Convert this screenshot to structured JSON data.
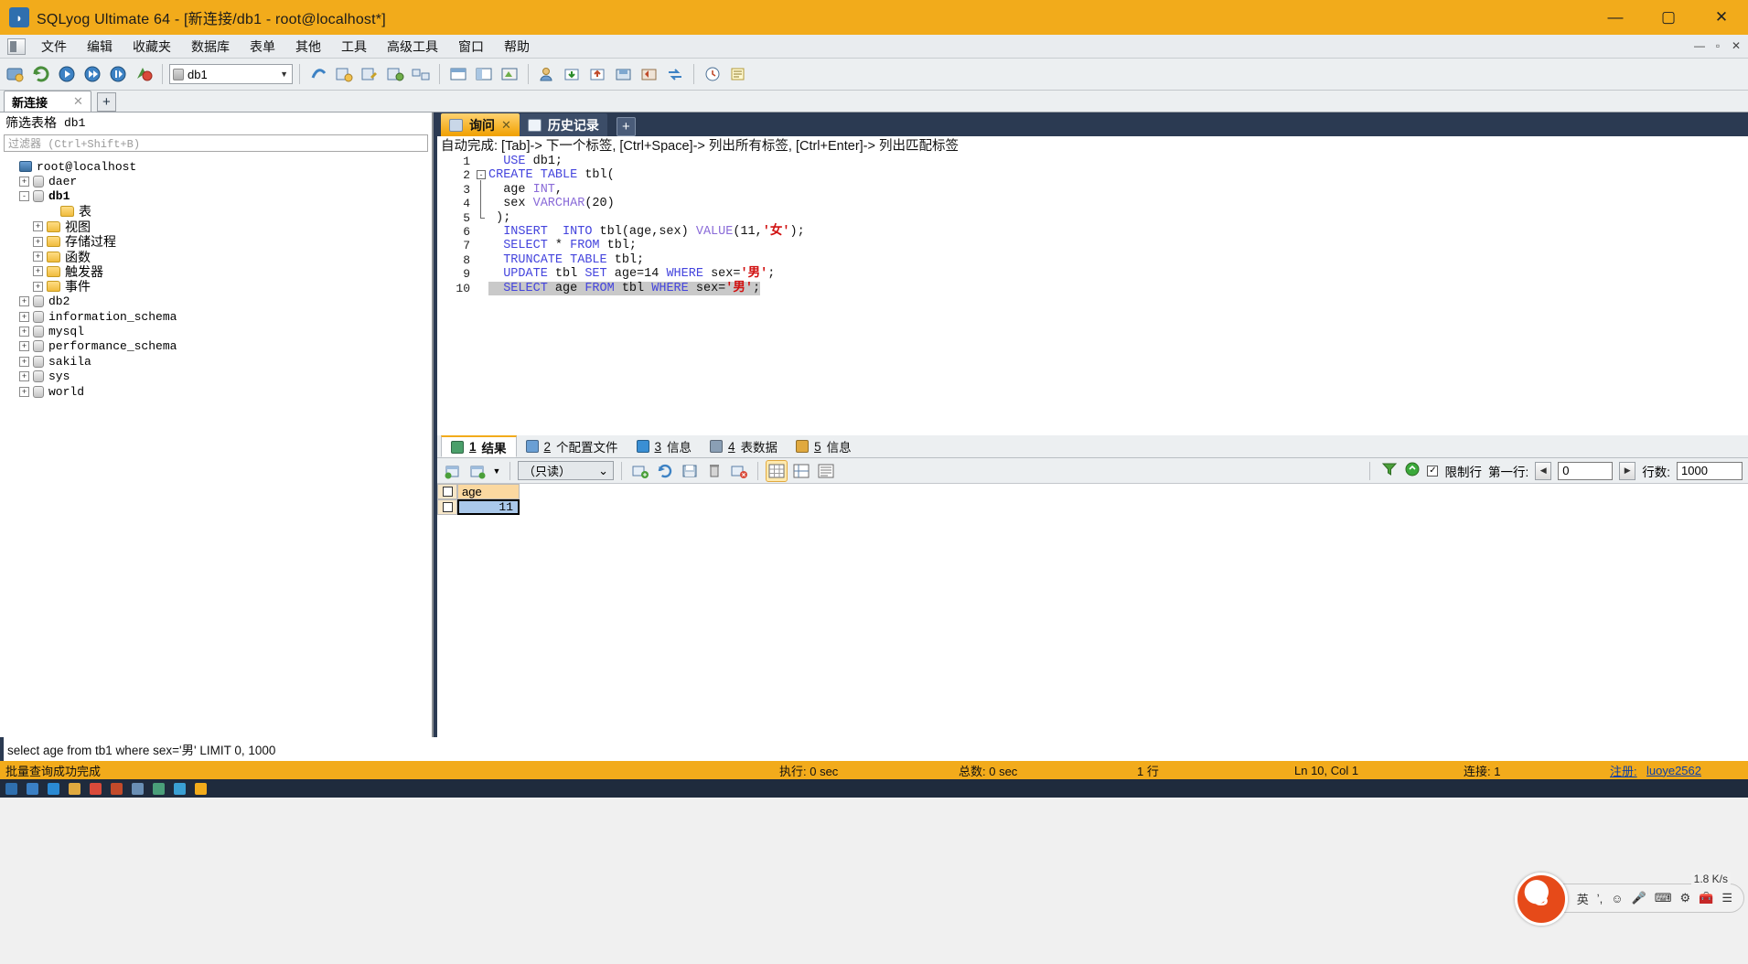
{
  "window": {
    "title": "SQLyog Ultimate 64 - [新连接/db1 - root@localhost*]",
    "app_icon": "sqlyog-icon",
    "minimize": "—",
    "maximize": "▢",
    "close": "✕",
    "accent_color": "#f2ab1b"
  },
  "menubar": {
    "items": [
      "文件",
      "编辑",
      "收藏夹",
      "数据库",
      "表单",
      "其他",
      "工具",
      "高级工具",
      "窗口",
      "帮助"
    ],
    "right_buttons": [
      "—",
      "▫",
      "✕"
    ]
  },
  "toolbar": {
    "database_selected": "db1",
    "buttons": [
      "new-connection-icon",
      "refresh-icon",
      "connect-icon",
      "disconnect-icon",
      "reconnect-icon",
      "favorites-icon",
      "new-query-icon",
      "execute-query-icon",
      "execute-all-icon",
      "stop-query-icon",
      "table-data-icon",
      "object-browser-icon",
      "schema-designer-icon",
      "query-builder-icon",
      "import-icon",
      "export-icon",
      "backup-icon",
      "restore-icon",
      "sync-icon",
      "scheduler-icon",
      "tunnel-icon",
      "migration-icon",
      "notes-icon"
    ]
  },
  "connection_tabs": {
    "tabs": [
      {
        "label": "新连接",
        "close": "✕",
        "active": true
      }
    ],
    "add_label": "+"
  },
  "sidebar": {
    "filter_label": "筛选表格",
    "filter_db": "db1",
    "filter_placeholder": "过滤器 (Ctrl+Shift+B)",
    "tree": [
      {
        "label": "root@localhost",
        "icon": "server-icon",
        "indent": 0,
        "expander": "none",
        "bold": false,
        "cjk": false
      },
      {
        "label": "daer",
        "icon": "database-icon",
        "indent": 1,
        "expander": "+",
        "bold": false,
        "cjk": false
      },
      {
        "label": "db1",
        "icon": "database-icon",
        "indent": 1,
        "expander": "-",
        "bold": true,
        "cjk": false
      },
      {
        "label": "表",
        "icon": "folder-icon",
        "indent": 3,
        "expander": "none",
        "bold": false,
        "cjk": true
      },
      {
        "label": "视图",
        "icon": "folder-icon",
        "indent": 2,
        "expander": "+",
        "bold": false,
        "cjk": true
      },
      {
        "label": "存储过程",
        "icon": "folder-icon",
        "indent": 2,
        "expander": "+",
        "bold": false,
        "cjk": true
      },
      {
        "label": "函数",
        "icon": "folder-icon",
        "indent": 2,
        "expander": "+",
        "bold": false,
        "cjk": true
      },
      {
        "label": "触发器",
        "icon": "folder-icon",
        "indent": 2,
        "expander": "+",
        "bold": false,
        "cjk": true
      },
      {
        "label": "事件",
        "icon": "folder-icon",
        "indent": 2,
        "expander": "+",
        "bold": false,
        "cjk": true
      },
      {
        "label": "db2",
        "icon": "database-icon",
        "indent": 1,
        "expander": "+",
        "bold": false,
        "cjk": false
      },
      {
        "label": "information_schema",
        "icon": "database-icon",
        "indent": 1,
        "expander": "+",
        "bold": false,
        "cjk": false
      },
      {
        "label": "mysql",
        "icon": "database-icon",
        "indent": 1,
        "expander": "+",
        "bold": false,
        "cjk": false
      },
      {
        "label": "performance_schema",
        "icon": "database-icon",
        "indent": 1,
        "expander": "+",
        "bold": false,
        "cjk": false
      },
      {
        "label": "sakila",
        "icon": "database-icon",
        "indent": 1,
        "expander": "+",
        "bold": false,
        "cjk": false
      },
      {
        "label": "sys",
        "icon": "database-icon",
        "indent": 1,
        "expander": "+",
        "bold": false,
        "cjk": false
      },
      {
        "label": "world",
        "icon": "database-icon",
        "indent": 1,
        "expander": "+",
        "bold": false,
        "cjk": false
      }
    ]
  },
  "editor": {
    "tabs": [
      {
        "label": "询问",
        "icon": "query-tab-icon",
        "close": "✕",
        "active": true
      },
      {
        "label": "历史记录",
        "icon": "history-tab-icon",
        "close": "",
        "active": false
      }
    ],
    "add_label": "+",
    "autocomplete_hint": "自动完成: [Tab]-> 下一个标签, [Ctrl+Space]-> 列出所有标签, [Ctrl+Enter]-> 列出匹配标签",
    "line_numbers": [
      "1",
      "2",
      "3",
      "4",
      "5",
      "6",
      "7",
      "8",
      "9",
      "10"
    ],
    "lines": [
      {
        "n": 1,
        "tokens": [
          {
            "t": "  ",
            "c": "pl"
          },
          {
            "t": "USE",
            "c": "kw"
          },
          {
            "t": " db1;",
            "c": "pl"
          }
        ]
      },
      {
        "n": 2,
        "tokens": [
          {
            "t": "",
            "c": "pl"
          },
          {
            "t": "CREATE",
            "c": "kw"
          },
          {
            "t": " ",
            "c": "pl"
          },
          {
            "t": "TABLE",
            "c": "kw"
          },
          {
            "t": " tbl(",
            "c": "pl"
          }
        ]
      },
      {
        "n": 3,
        "tokens": [
          {
            "t": "  age ",
            "c": "pl"
          },
          {
            "t": "INT",
            "c": "kw2"
          },
          {
            "t": ",",
            "c": "pl"
          }
        ]
      },
      {
        "n": 4,
        "tokens": [
          {
            "t": "  sex ",
            "c": "pl"
          },
          {
            "t": "VARCHAR",
            "c": "kw2"
          },
          {
            "t": "(20)",
            "c": "pl"
          }
        ]
      },
      {
        "n": 5,
        "tokens": [
          {
            "t": " );",
            "c": "pl"
          }
        ]
      },
      {
        "n": 6,
        "tokens": [
          {
            "t": "  ",
            "c": "pl"
          },
          {
            "t": "INSERT",
            "c": "kw"
          },
          {
            "t": "  ",
            "c": "pl"
          },
          {
            "t": "INTO",
            "c": "kw"
          },
          {
            "t": " tbl(age,sex) ",
            "c": "pl"
          },
          {
            "t": "VALUE",
            "c": "kw2"
          },
          {
            "t": "(11,",
            "c": "pl"
          },
          {
            "t": "'女'",
            "c": "str"
          },
          {
            "t": ");",
            "c": "pl"
          }
        ]
      },
      {
        "n": 7,
        "tokens": [
          {
            "t": "  ",
            "c": "pl"
          },
          {
            "t": "SELECT",
            "c": "kw"
          },
          {
            "t": " * ",
            "c": "pl"
          },
          {
            "t": "FROM",
            "c": "kw"
          },
          {
            "t": " tbl;",
            "c": "pl"
          }
        ]
      },
      {
        "n": 8,
        "tokens": [
          {
            "t": "  ",
            "c": "pl"
          },
          {
            "t": "TRUNCATE",
            "c": "kw"
          },
          {
            "t": " ",
            "c": "pl"
          },
          {
            "t": "TABLE",
            "c": "kw"
          },
          {
            "t": " tbl;",
            "c": "pl"
          }
        ]
      },
      {
        "n": 9,
        "tokens": [
          {
            "t": "  ",
            "c": "pl"
          },
          {
            "t": "UPDATE",
            "c": "kw"
          },
          {
            "t": " tbl ",
            "c": "pl"
          },
          {
            "t": "SET",
            "c": "kw"
          },
          {
            "t": " age=14 ",
            "c": "pl"
          },
          {
            "t": "WHERE",
            "c": "kw"
          },
          {
            "t": " sex=",
            "c": "pl"
          },
          {
            "t": "'男'",
            "c": "str"
          },
          {
            "t": ";",
            "c": "pl"
          }
        ]
      },
      {
        "n": 10,
        "highlighted": true,
        "tokens": [
          {
            "t": "  ",
            "c": "pl"
          },
          {
            "t": "SELECT",
            "c": "kw"
          },
          {
            "t": " age ",
            "c": "pl"
          },
          {
            "t": "FROM",
            "c": "kw"
          },
          {
            "t": " tbl ",
            "c": "pl"
          },
          {
            "t": "WHERE",
            "c": "kw"
          },
          {
            "t": " sex=",
            "c": "pl"
          },
          {
            "t": "'男'",
            "c": "str"
          },
          {
            "t": ";",
            "c": "pl"
          }
        ]
      }
    ],
    "fold_marker": "-"
  },
  "results": {
    "tabs": [
      {
        "num": "1",
        "label": "结果",
        "icon": "result-grid-icon",
        "active": true
      },
      {
        "num": "2",
        "label": "个配置文件",
        "icon": "profile-icon",
        "active": false
      },
      {
        "num": "3",
        "label": "信息",
        "icon": "info-icon",
        "active": false
      },
      {
        "num": "4",
        "label": "表数据",
        "icon": "table-data-icon",
        "active": false
      },
      {
        "num": "5",
        "label": "信息",
        "icon": "messages-icon",
        "active": false
      }
    ],
    "toolbar": {
      "mode_select": "（只读）",
      "mode_arrow": "⌄",
      "buttons": [
        "new-row-icon",
        "refresh-grid-icon",
        "save-changes-icon",
        "delete-row-icon",
        "cancel-changes-icon"
      ],
      "view_buttons": [
        "grid-view-icon",
        "form-view-icon",
        "text-view-icon"
      ],
      "filter_icon": "filter-icon",
      "refresh_icon": "refresh-icon",
      "limit_checkbox_label": "限制行",
      "limit_checked": "✓",
      "first_row_label": "第一行:",
      "first_row_value": "0",
      "prev_arrow": "◀",
      "next_arrow": "▶",
      "rows_label": "行数:",
      "rows_value": "1000"
    },
    "grid": {
      "columns": [
        "age"
      ],
      "rows": [
        [
          "11"
        ]
      ]
    }
  },
  "query_echo": "select age from tb1 where sex='男' LIMIT 0, 1000",
  "statusbar": {
    "left": "批量查询成功完成",
    "exec_time": "执行: 0 sec",
    "total_time": "总数: 0 sec",
    "row_count": "1 行",
    "cursor": "Ln 10, Col 1",
    "connection": "连接: 1",
    "register_label": "注册:",
    "register_user": "luoye2562"
  },
  "ime": {
    "lang": "英",
    "items": [
      "half-width-icon",
      "emoji-icon",
      "voice-icon",
      "keyboard-icon",
      "settings-icon",
      "toolbox-icon",
      "menu-icon"
    ],
    "speed": "1.8 K/s"
  }
}
